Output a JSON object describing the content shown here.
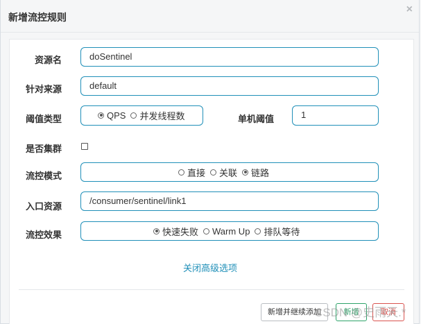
{
  "dialog": {
    "title": "新增流控规则",
    "close": "×"
  },
  "form": {
    "resource": {
      "label": "资源名",
      "value": "doSentinel"
    },
    "source": {
      "label": "针对来源",
      "value": "default"
    },
    "threshold_type": {
      "label": "阈值类型",
      "options": [
        {
          "label": "QPS",
          "selected": true
        },
        {
          "label": "并发线程数",
          "selected": false
        }
      ]
    },
    "single_threshold": {
      "label": "单机阈值",
      "value": "1"
    },
    "cluster": {
      "label": "是否集群",
      "checked": false
    },
    "flow_mode": {
      "label": "流控模式",
      "options": [
        {
          "label": "直接",
          "selected": false
        },
        {
          "label": "关联",
          "selected": false
        },
        {
          "label": "链路",
          "selected": true
        }
      ]
    },
    "entry_resource": {
      "label": "入口资源",
      "value": "/consumer/sentinel/link1"
    },
    "flow_effect": {
      "label": "流控效果",
      "options": [
        {
          "label": "快速失败",
          "selected": true
        },
        {
          "label": "Warm Up",
          "selected": false
        },
        {
          "label": "排队等待",
          "selected": false
        }
      ]
    },
    "advanced_toggle": "关闭高级选项"
  },
  "footer": {
    "add_continue": "新增并继续添加",
    "add": "新增",
    "cancel": "取消"
  },
  "watermark": "CSDN @史雨天.*",
  "colors": {
    "accent": "#1f8fb8",
    "add": "#2ea36a",
    "cancel": "#d9534f"
  }
}
